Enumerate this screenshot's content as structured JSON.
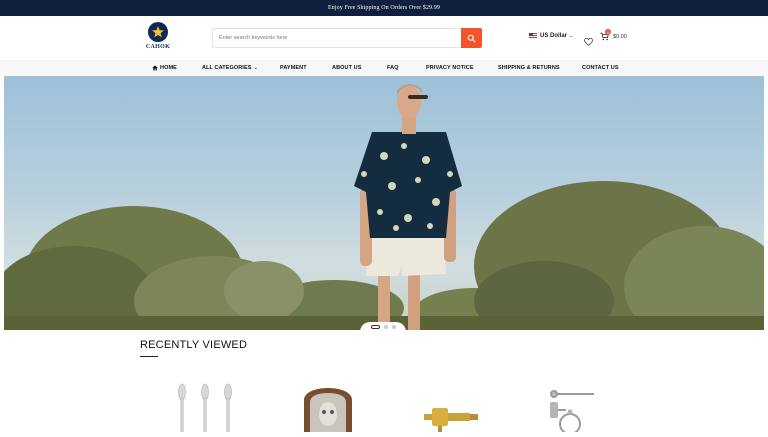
{
  "promo": {
    "text": "Enjoy Free Shipping On Orders Over $29.99"
  },
  "brand": {
    "name": "CAHOK"
  },
  "search": {
    "placeholder": "Enter search keywords here"
  },
  "currency": {
    "label": "US Dollar"
  },
  "cart": {
    "count": "0",
    "total": "$0.00"
  },
  "nav": {
    "home": "HOME",
    "categories": "ALL CATEGORIES",
    "payment": "PAYMENT",
    "about": "ABOUT US",
    "faq": "FAQ",
    "privacy": "PRIVACY NOTICE",
    "shipping": "SHIPPING & RETURNS",
    "contact": "CONTACT US"
  },
  "recently_viewed": {
    "title": "RECENTLY VIEWED"
  },
  "colors": {
    "topbar": "#0f1f3d",
    "accent": "#f0552c",
    "brand": "#0f2a55"
  },
  "icons": [
    "star-logo-icon",
    "search-icon",
    "chevron-down-icon",
    "heart-icon",
    "cart-icon",
    "home-icon"
  ]
}
